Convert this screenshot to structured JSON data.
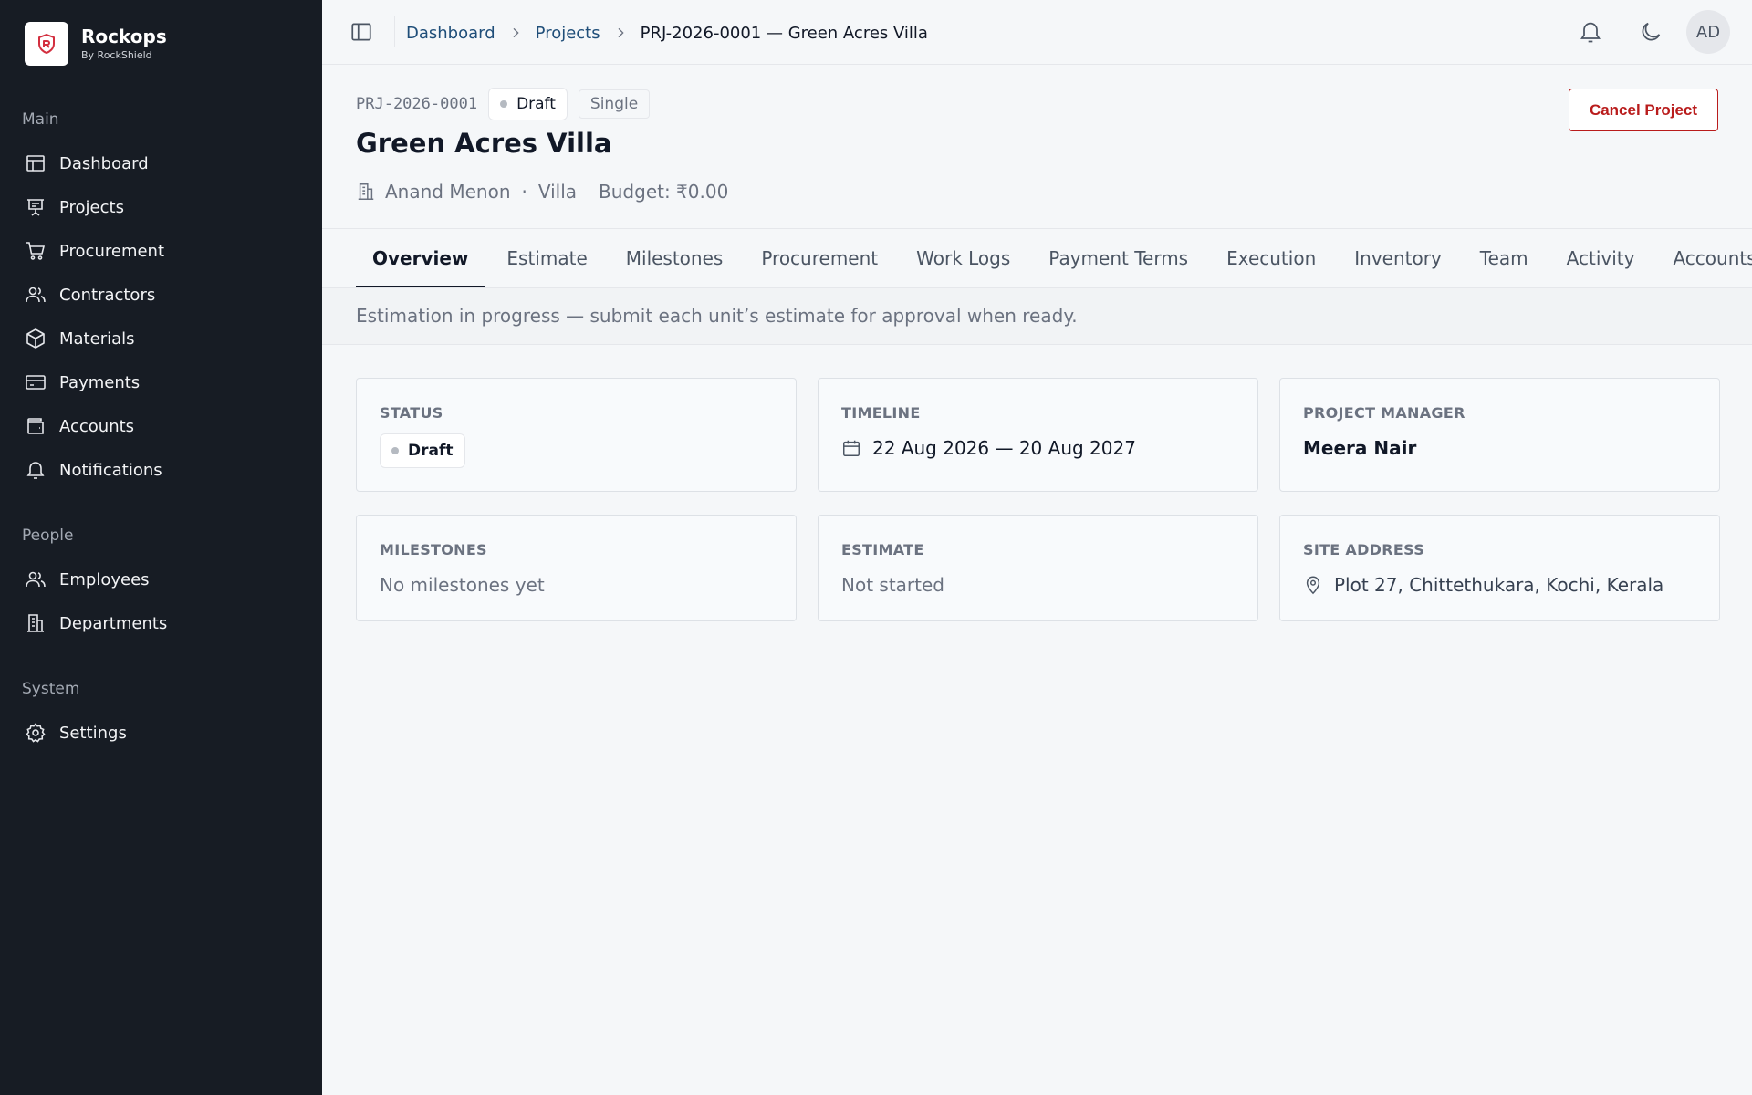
{
  "brand": {
    "name": "Rockops",
    "subtitle": "By RockShield"
  },
  "sidebar": {
    "sections": [
      {
        "heading": "Main",
        "items": [
          {
            "label": "Dashboard",
            "icon": "dashboard-icon"
          },
          {
            "label": "Projects",
            "icon": "projects-icon"
          },
          {
            "label": "Procurement",
            "icon": "cart-icon"
          },
          {
            "label": "Contractors",
            "icon": "users-icon"
          },
          {
            "label": "Materials",
            "icon": "box-icon"
          },
          {
            "label": "Payments",
            "icon": "credit-card-icon"
          },
          {
            "label": "Accounts",
            "icon": "wallet-icon"
          },
          {
            "label": "Notifications",
            "icon": "bell-icon"
          }
        ]
      },
      {
        "heading": "People",
        "items": [
          {
            "label": "Employees",
            "icon": "users-icon"
          },
          {
            "label": "Departments",
            "icon": "building-icon"
          }
        ]
      },
      {
        "heading": "System",
        "items": [
          {
            "label": "Settings",
            "icon": "gear-icon"
          }
        ]
      }
    ]
  },
  "breadcrumb": {
    "items": [
      "Dashboard",
      "Projects"
    ],
    "current": "PRJ-2026-0001 — Green Acres Villa"
  },
  "user": {
    "initials": "AD"
  },
  "project": {
    "code": "PRJ-2026-0001",
    "status": "Draft",
    "type": "Single",
    "title": "Green Acres Villa",
    "client": "Anand Menon",
    "category": "Villa",
    "budget": "Budget: ₹0.00",
    "cancel_label": "Cancel Project"
  },
  "tabs": [
    "Overview",
    "Estimate",
    "Milestones",
    "Procurement",
    "Work Logs",
    "Payment Terms",
    "Execution",
    "Inventory",
    "Team",
    "Activity",
    "Accounts"
  ],
  "active_tab": "Overview",
  "info_message": "Estimation in progress — submit each unit’s estimate for approval when ready.",
  "cards": {
    "status": {
      "label": "STATUS",
      "value": "Draft"
    },
    "timeline": {
      "label": "TIMELINE",
      "value": "22 Aug 2026 — 20 Aug 2027"
    },
    "manager": {
      "label": "PROJECT MANAGER",
      "value": "Meera Nair"
    },
    "milestones": {
      "label": "MILESTONES",
      "value": "No milestones yet"
    },
    "estimate": {
      "label": "ESTIMATE",
      "value": "Not started"
    },
    "site": {
      "label": "SITE ADDRESS",
      "value": "Plot 27, Chittethukara, Kochi, Kerala"
    }
  },
  "colors": {
    "sidebar_bg": "#171c24",
    "accent_link": "#1f4e79",
    "danger": "#b91c1c",
    "page_bg": "#f5f7f9"
  }
}
